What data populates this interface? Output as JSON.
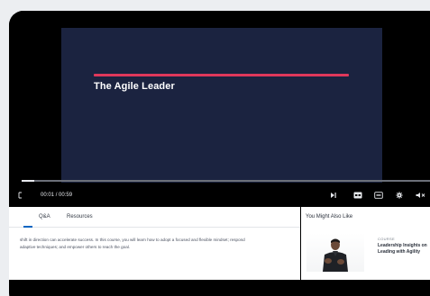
{
  "video": {
    "slide_title": "The Agile Leader",
    "current_time": "00:01",
    "duration": "00:59",
    "time_separator": "/",
    "progress": 0.03,
    "accent_color": "#e0385b",
    "slide_bg_color": "#1b2340"
  },
  "controls": {
    "fullscreen_toggle": "fullscreen-exit-icon",
    "skip": "skip-next-icon",
    "captions": "closed-captions-icon",
    "transcript": "transcript-icon",
    "settings": "gear-icon",
    "volume": "volume-mute-icon"
  },
  "tabs": [
    {
      "label": "Q&A",
      "active": false
    },
    {
      "label": "Resources",
      "active": false
    }
  ],
  "description": {
    "line1": "shift in direction can accelerate success. In this course, you will learn how to adopt a focused and flexible mindset; respond",
    "line2": "adaptive techniques; and empower others to reach the goal."
  },
  "recommendations": {
    "title": "You Might Also Like",
    "items": [
      {
        "type": "COURSE",
        "title": "Leadership Insights on Leading with Agility"
      }
    ]
  }
}
